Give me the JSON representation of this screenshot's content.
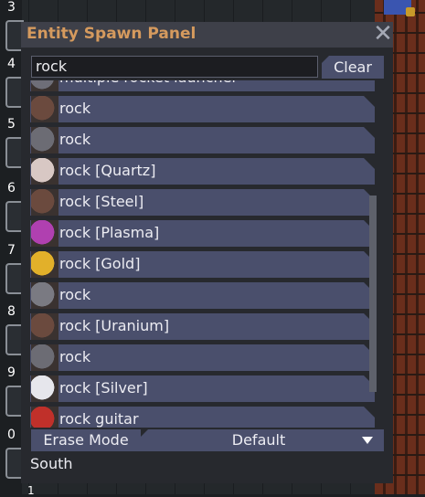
{
  "hotbar": {
    "slots": [
      {
        "num": "3"
      },
      {
        "num": "4"
      },
      {
        "num": "5"
      },
      {
        "num": "6"
      },
      {
        "num": "7"
      },
      {
        "num": "8"
      },
      {
        "num": "9"
      },
      {
        "num": "0"
      }
    ],
    "bottom_num": "1"
  },
  "panel": {
    "title": "Entity Spawn Panel",
    "search_value": "rock",
    "clear_label": "Clear",
    "items": [
      {
        "label": "multiple rocket launcher",
        "icon": "rocket-launcher-icon",
        "color": "#6e6e78"
      },
      {
        "label": "rock",
        "icon": "rock-brown-icon",
        "color": "#6b4a3e"
      },
      {
        "label": "rock",
        "icon": "rock-grey-icon",
        "color": "#6c6c74"
      },
      {
        "label": "rock [Quartz]",
        "icon": "rock-quartz-icon",
        "color": "#d8c8c4"
      },
      {
        "label": "rock [Steel]",
        "icon": "rock-steel-icon",
        "color": "#6b4a3e"
      },
      {
        "label": "rock [Plasma]",
        "icon": "rock-plasma-icon",
        "color": "#b040b0"
      },
      {
        "label": "rock [Gold]",
        "icon": "rock-gold-icon",
        "color": "#e2b02a"
      },
      {
        "label": "rock",
        "icon": "rock-grey-icon",
        "color": "#7a7a82"
      },
      {
        "label": "rock [Uranium]",
        "icon": "rock-uranium-icon",
        "color": "#6b4a3e"
      },
      {
        "label": "rock",
        "icon": "rock-grey-icon",
        "color": "#6c6c74"
      },
      {
        "label": "rock [Silver]",
        "icon": "rock-silver-icon",
        "color": "#e6e6ec"
      },
      {
        "label": "rock guitar",
        "icon": "guitar-icon",
        "color": "#c0302a"
      }
    ],
    "erase_mode_label": "Erase Mode",
    "dropdown_value": "Default",
    "direction": "South"
  }
}
